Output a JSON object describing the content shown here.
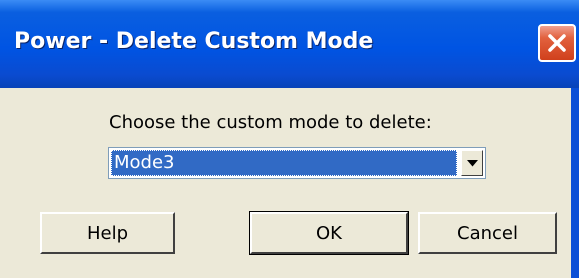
{
  "window": {
    "title": "Power - Delete Custom Mode"
  },
  "title_bar": {
    "close_icon": "close-x-icon"
  },
  "dialog": {
    "prompt": "Choose the custom mode to delete:",
    "mode_select": {
      "selected_value": "Mode3",
      "dropdown_icon": "dropdown-arrow-icon"
    }
  },
  "buttons": {
    "help_label": "Help",
    "ok_label": "OK",
    "cancel_label": "Cancel"
  },
  "colors": {
    "title_bar": "#0054e3",
    "dialog_background": "#ece9d8",
    "selection": "#316ac5",
    "close_button": "#e2613e"
  }
}
